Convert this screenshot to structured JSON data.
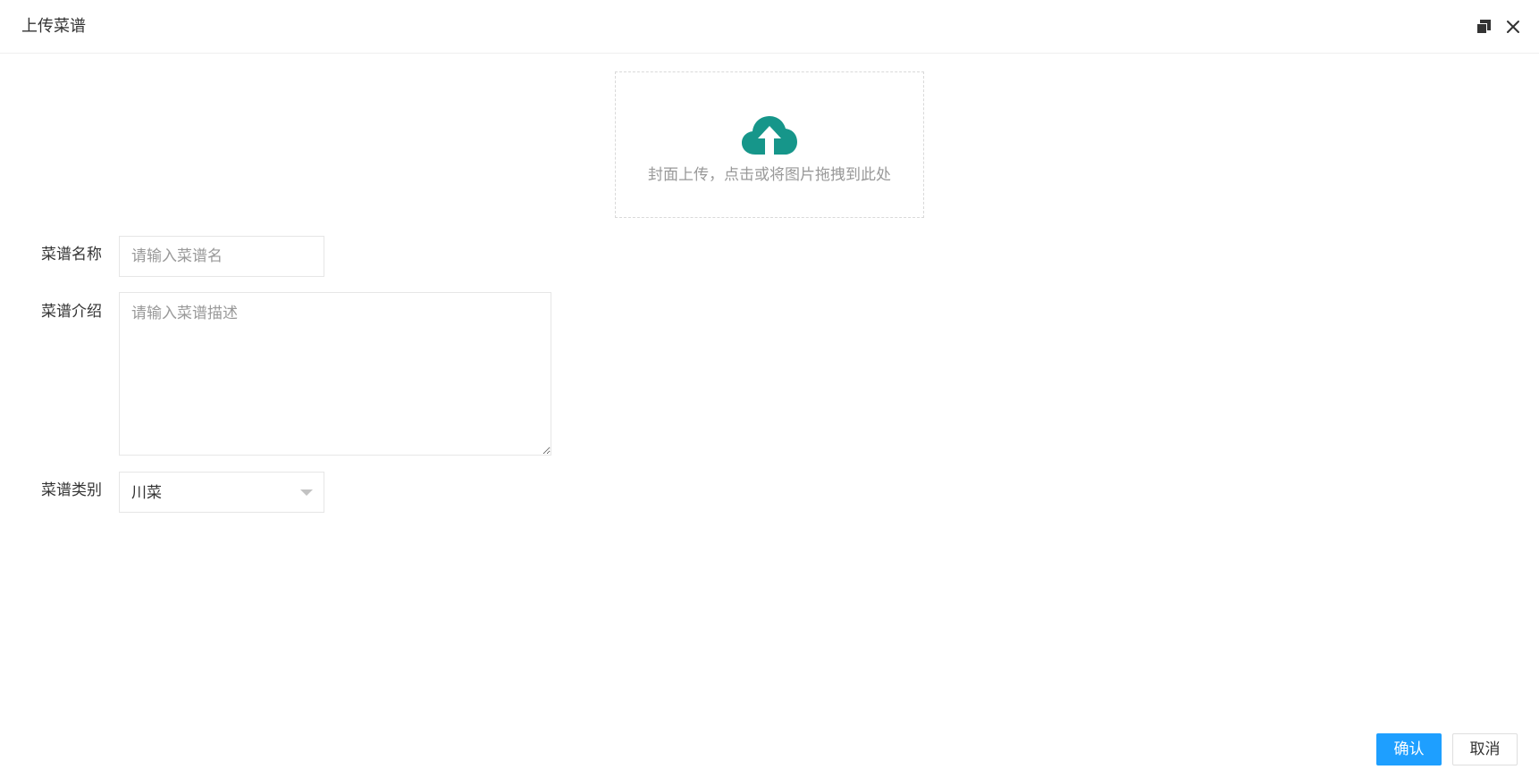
{
  "dialog": {
    "title": "上传菜谱"
  },
  "upload": {
    "hint": "封面上传，点击或将图片拖拽到此处",
    "icon": "cloud-upload-icon",
    "icon_color": "#16968a"
  },
  "form": {
    "name": {
      "label": "菜谱名称",
      "placeholder": "请输入菜谱名"
    },
    "description": {
      "label": "菜谱介绍",
      "placeholder": "请输入菜谱描述"
    },
    "category": {
      "label": "菜谱类别",
      "value": "川菜"
    }
  },
  "actions": {
    "confirm_label": "确认",
    "cancel_label": "取消",
    "primary_color": "#1e9fff"
  }
}
